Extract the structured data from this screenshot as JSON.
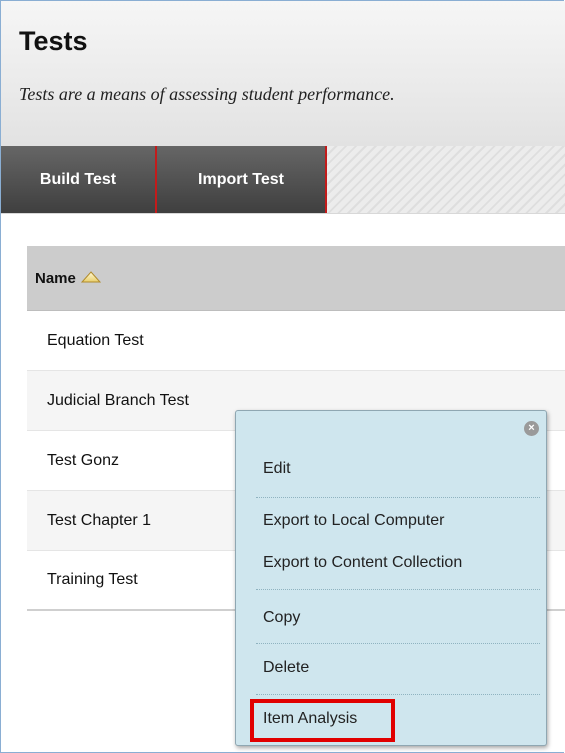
{
  "page": {
    "title": "Tests",
    "description": "Tests are a means of assessing student performance."
  },
  "action_bar": {
    "build_label": "Build Test",
    "import_label": "Import Test"
  },
  "table": {
    "name_header": "Name",
    "sort_icon": "sort-ascending-triangle-icon",
    "rows": [
      "Equation Test",
      "Judicial Branch Test",
      "Test Gonz",
      "Test Chapter 1",
      "Training Test"
    ]
  },
  "context_menu": {
    "close_icon": "close-circle-icon",
    "items": [
      "Edit",
      "Export to Local Computer",
      "Export to Content Collection",
      "Copy",
      "Delete",
      "Item Analysis"
    ],
    "highlighted_item": "Item Analysis"
  },
  "colors": {
    "action_button_bg": "#4f4f4f",
    "action_button_divider": "#c31b1b",
    "menu_bg": "#cfe6ee",
    "highlight": "#e10000",
    "table_header_bg": "#cccccc"
  }
}
